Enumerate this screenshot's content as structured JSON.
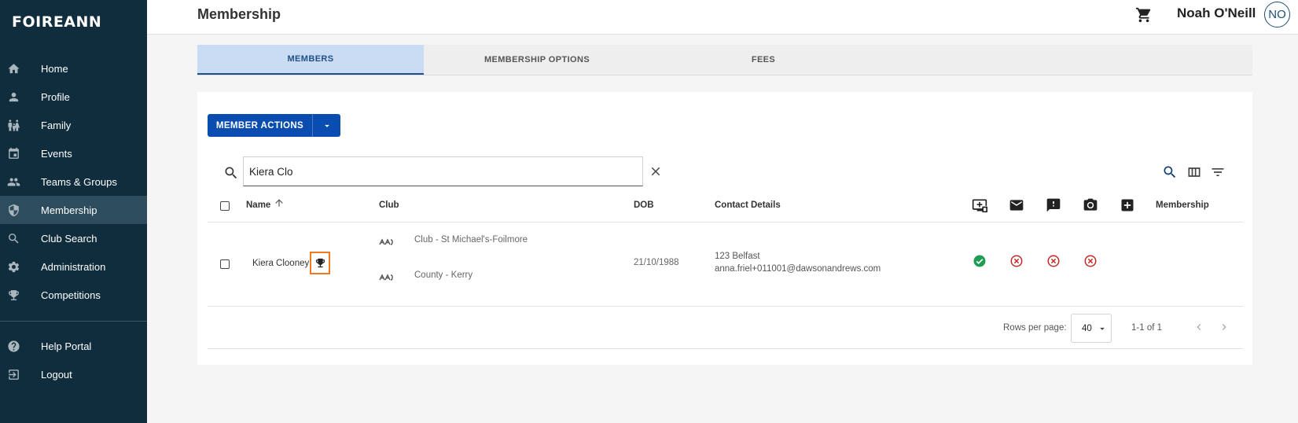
{
  "app": {
    "logo": "FOIREANN"
  },
  "sidebar": {
    "items": [
      {
        "label": "Home",
        "icon": "home-icon"
      },
      {
        "label": "Profile",
        "icon": "person-icon"
      },
      {
        "label": "Family",
        "icon": "family-icon"
      },
      {
        "label": "Events",
        "icon": "calendar-icon"
      },
      {
        "label": "Teams & Groups",
        "icon": "group-icon"
      },
      {
        "label": "Membership",
        "icon": "shield-icon",
        "active": true
      },
      {
        "label": "Club Search",
        "icon": "search-icon"
      },
      {
        "label": "Administration",
        "icon": "gear-icon"
      },
      {
        "label": "Competitions",
        "icon": "trophy-icon"
      }
    ],
    "bottom_items": [
      {
        "label": "Help Portal",
        "icon": "help-icon"
      },
      {
        "label": "Logout",
        "icon": "logout-icon"
      }
    ]
  },
  "header": {
    "title": "Membership",
    "user_name": "Noah O'Neill",
    "user_initials": "NO"
  },
  "tabs": [
    {
      "label": "MEMBERS",
      "active": true
    },
    {
      "label": "MEMBERSHIP OPTIONS",
      "active": false
    },
    {
      "label": "FEES",
      "active": false
    }
  ],
  "toolbar": {
    "member_actions_label": "MEMBER ACTIONS",
    "search_value": "Kiera Clo"
  },
  "table": {
    "columns": {
      "name": "Name",
      "club": "Club",
      "dob": "DOB",
      "contact": "Contact Details",
      "membership": "Membership"
    },
    "rows": [
      {
        "name": "Kiera Clooney",
        "club_1": "Club - St Michael's-Foilmore",
        "club_2": "County - Kerry",
        "dob": "21/10/1988",
        "address": "123 Belfast",
        "email": "anna.friel+011001@dawsonandrews.com",
        "status": [
          "ok",
          "fail",
          "fail",
          "fail"
        ]
      }
    ]
  },
  "pagination": {
    "rows_per_page_label": "Rows per page:",
    "rows_per_page": "40",
    "range": "1-1 of 1"
  },
  "colors": {
    "sidebar_bg": "#0f2d3c",
    "primary_button": "#0a4db0",
    "active_tab": "#c9dcf4",
    "success": "#1f9d55",
    "error": "#c62828",
    "highlight": "#f0781e"
  }
}
